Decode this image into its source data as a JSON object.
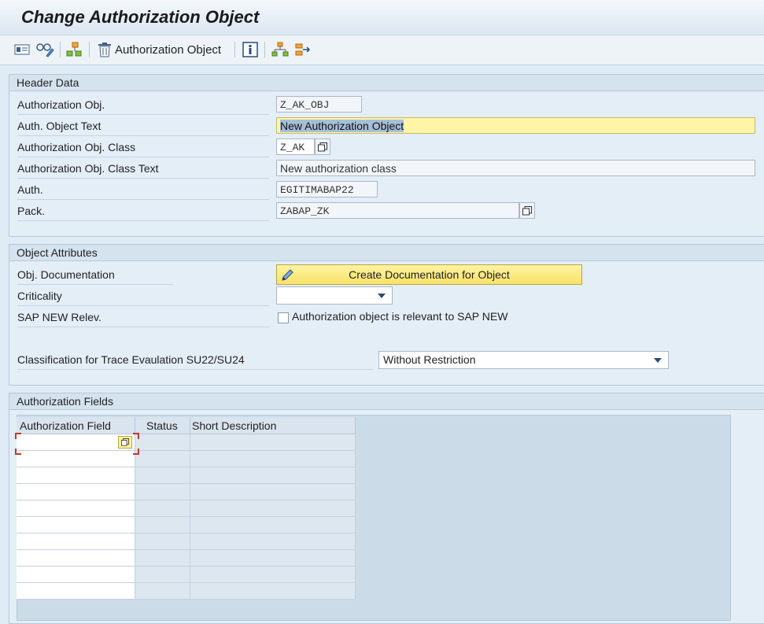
{
  "title": "Change Authorization Object",
  "toolbar": {
    "icons": [
      "display-change-icon",
      "glasses-icon",
      "where-used-icon",
      "trash-icon",
      "info-icon",
      "hierarchy-icon",
      "navigate-icon"
    ],
    "delete_label": "Authorization Object"
  },
  "header_data": {
    "title": "Header Data",
    "auth_obj_label": "Authorization Obj.",
    "auth_obj_value": "Z_AK_OBJ",
    "auth_text_label": "Auth. Object Text",
    "auth_text_value": "New Authorization Object",
    "class_label": "Authorization Obj. Class",
    "class_value": "Z_AK",
    "class_text_label": "Authorization Obj. Class Text",
    "class_text_value": "New authorization class",
    "auth_label": "Auth.",
    "auth_value": "EGITIMABAP22",
    "pack_label": "Pack.",
    "pack_value": "ZABAP_ZK"
  },
  "object_attributes": {
    "title": "Object Attributes",
    "doc_label": "Obj. Documentation",
    "doc_button": "Create Documentation for Object",
    "criticality_label": "Criticality",
    "criticality_value": "",
    "sap_new_label": "SAP NEW Relev.",
    "sap_new_checkbox_label": "Authorization object is relevant to SAP NEW",
    "sap_new_checked": false,
    "trace_label": "Classification for Trace Evaulation SU22/SU24",
    "trace_value": "Without Restriction"
  },
  "authorization_fields": {
    "title": "Authorization Fields",
    "columns": [
      "Authorization Field",
      "Status",
      "Short Description"
    ],
    "rows": 10
  },
  "colors": {
    "background": "#dfebf5",
    "highlight_field": "#fff4a8",
    "button_yellow": "#f8e26a"
  }
}
